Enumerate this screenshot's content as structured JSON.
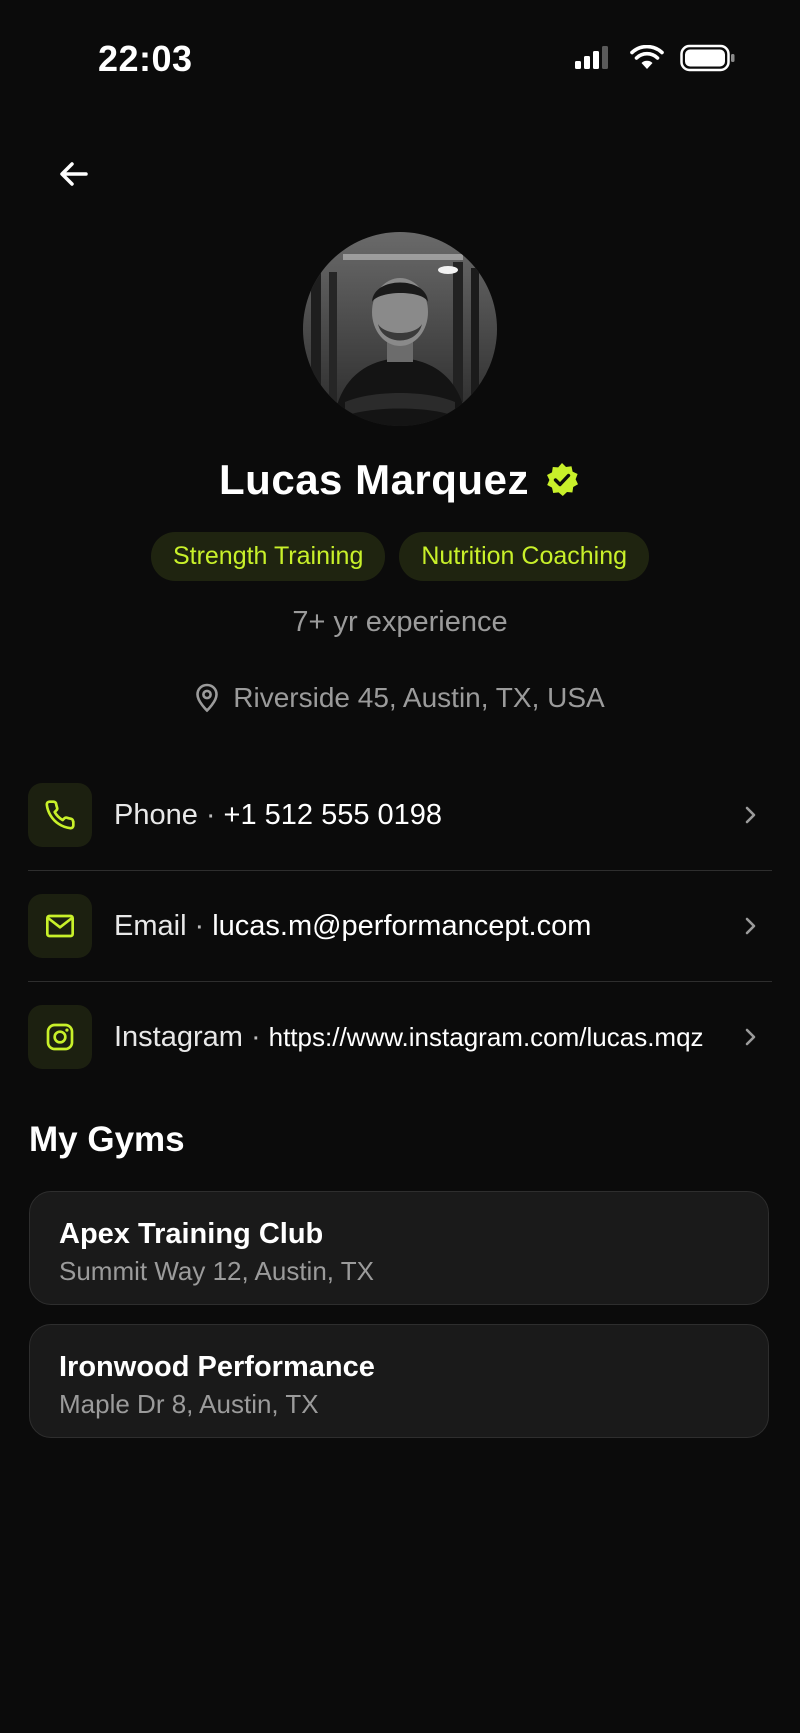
{
  "status_bar": {
    "time": "22:03",
    "icons": [
      "signal-icon",
      "wifi-icon",
      "battery-icon"
    ]
  },
  "header": {
    "back_icon": "arrow-left-icon"
  },
  "profile": {
    "name": "Lucas Marquez",
    "verified_icon": "verified-badge-icon",
    "tags": [
      "Strength Training",
      "Nutrition Coaching"
    ],
    "experience": "7+ yr experience",
    "location": "Riverside 45, Austin, TX, USA",
    "location_icon": "map-pin-icon"
  },
  "contacts": [
    {
      "label": "Phone",
      "separator": "·",
      "value": "+1 512 555 0198",
      "icon": "phone-icon"
    },
    {
      "label": "Email",
      "separator": "·",
      "value": "lucas.m@performancept.com",
      "icon": "mail-icon"
    },
    {
      "label": "Instagram",
      "separator": "·",
      "value": "https://www.instagram.com/lucas.mqz",
      "icon": "instagram-icon"
    }
  ],
  "gyms_section": {
    "title": "My Gyms",
    "gyms": [
      {
        "name": "Apex Training Club",
        "address": "Summit Way 12, Austin, TX"
      },
      {
        "name": "Ironwood Performance",
        "address": "Maple Dr 8, Austin, TX"
      }
    ]
  },
  "colors": {
    "background": "#0b0b0b",
    "accent": "#c8f02a",
    "tag_background": "#1f2410",
    "muted_text": "#9b9b9b",
    "card_background": "#1a1a1a"
  }
}
